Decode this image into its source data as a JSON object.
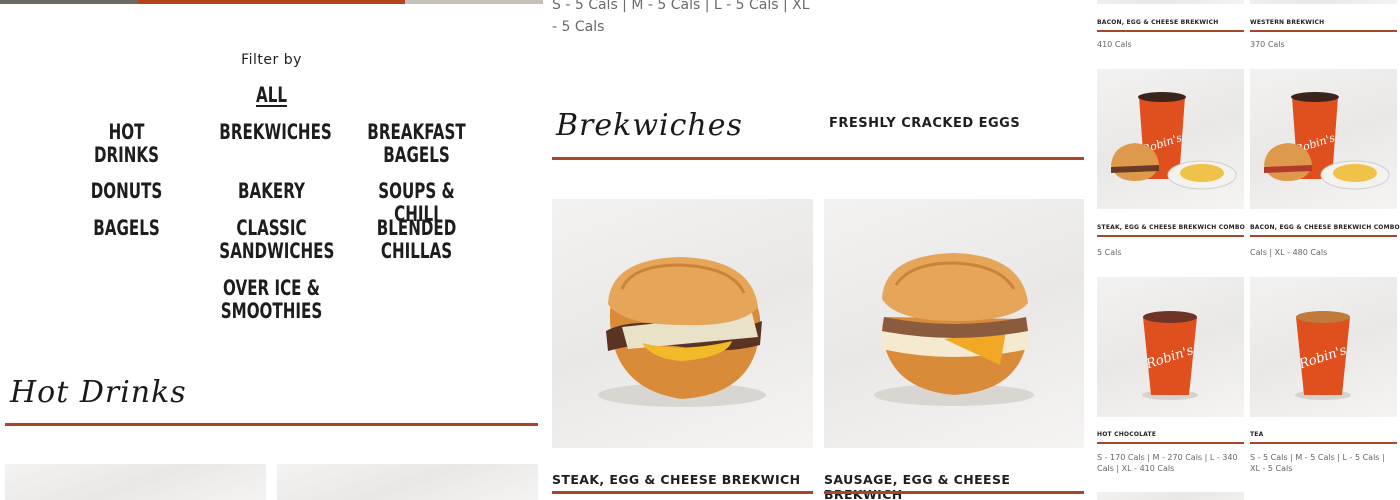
{
  "filter": {
    "title": "Filter by",
    "items": [
      "All",
      "Hot Drinks",
      "Brekwiches",
      "Breakfast Bagels",
      "Donuts",
      "Bakery",
      "Soups & Chili",
      "Bagels",
      "Classic Sandwiches",
      "Blended Chillas",
      "Over Ice & Smoothies"
    ],
    "active": "All"
  },
  "sections": {
    "hot_drinks": "Hot Drinks",
    "brekwiches": "Brekwiches"
  },
  "middle": {
    "top_cals": "S - 5 Cals | M - 5 Cals | L - 5 Cals | XL - 5 Cals",
    "badge": "FRESHLY CRACKED EGGS",
    "products": [
      {
        "name": "STEAK, EGG & CHEESE BREKWICH"
      },
      {
        "name": "SAUSAGE, EGG & CHEESE BREKWICH"
      }
    ]
  },
  "right": {
    "row1": [
      {
        "name": "BACON, EGG & CHEESE BREKWICH",
        "cals": "410 Cals"
      },
      {
        "name": "WESTERN BREKWICH",
        "cals": "370 Cals"
      }
    ],
    "row2": [
      {
        "name": "STEAK, EGG & CHEESE BREKWICH COMBO",
        "cals": "5 Cals"
      },
      {
        "name": "BACON, EGG & CHEESE BREKWICH COMBO",
        "cals": "Cals | XL - 480 Cals"
      }
    ],
    "row3": [
      {
        "name": "HOT CHOCOLATE",
        "cals": "S - 170 Cals | M - 270 Cals | L - 340 Cals | XL - 410 Cals"
      },
      {
        "name": "TEA",
        "cals": "S - 5 Cals | M - 5 Cals | L - 5 Cals | XL - 5 Cals"
      }
    ],
    "cup_brand": "Robin's"
  },
  "colors": {
    "accent": "#a7472a",
    "brand_cup": "#e0501f"
  }
}
